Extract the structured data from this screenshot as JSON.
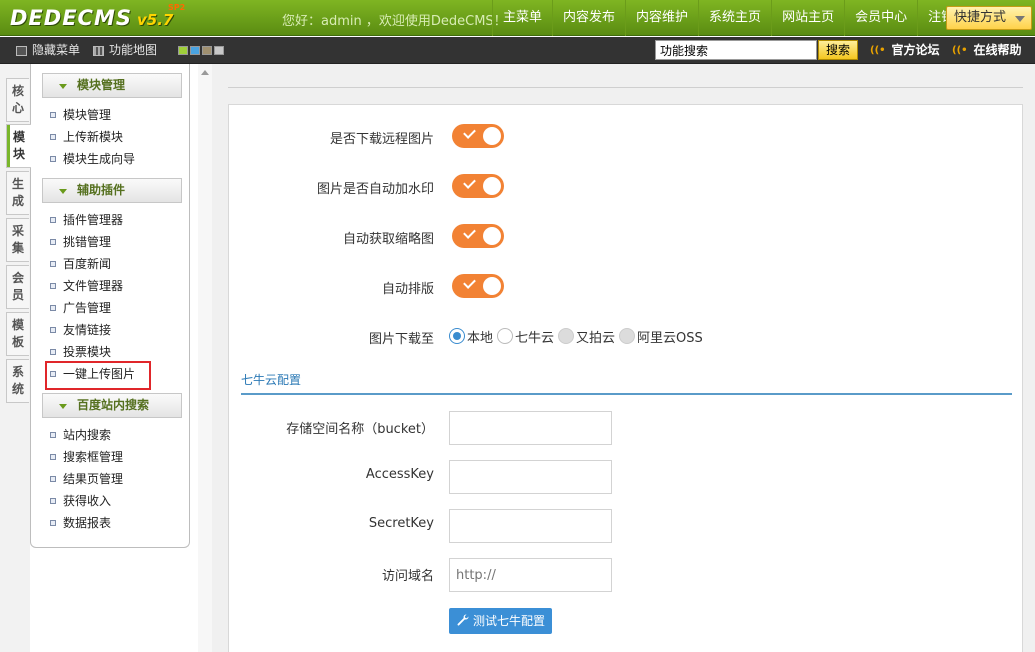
{
  "header": {
    "logo_text": "DEDECMS",
    "logo_version": "v5.7",
    "logo_edition": "SP2",
    "welcome": "您好：admin ，欢迎使用DedeCMS！",
    "nav": [
      "主菜单",
      "内容发布",
      "内容维护",
      "系统主页",
      "网站主页",
      "会员中心",
      "注销"
    ],
    "quick_label": "快捷方式"
  },
  "subbar": {
    "hide_menu": "隐藏菜单",
    "func_map": "功能地图",
    "search_value": "功能搜索",
    "search_button": "搜索",
    "forum_link": "官方论坛",
    "help_link": "在线帮助"
  },
  "vtabs": [
    "核心",
    "模块",
    "生成",
    "采集",
    "会员",
    "模板",
    "系统"
  ],
  "menu": {
    "groups": [
      {
        "title": "模块管理",
        "items": [
          "模块管理",
          "上传新模块",
          "模块生成向导"
        ]
      },
      {
        "title": "辅助插件",
        "items": [
          "插件管理器",
          "挑错管理",
          "百度新闻",
          "文件管理器",
          "广告管理",
          "友情链接",
          "投票模块",
          "一键上传图片"
        ]
      },
      {
        "title": "百度站内搜索",
        "items": [
          "站内搜索",
          "搜索框管理",
          "结果页管理",
          "获得收入",
          "数据报表"
        ]
      }
    ]
  },
  "form": {
    "toggles": [
      {
        "label": "是否下载远程图片",
        "on": true
      },
      {
        "label": "图片是否自动加水印",
        "on": true
      },
      {
        "label": "自动获取缩略图",
        "on": true
      },
      {
        "label": "自动排版",
        "on": true
      }
    ],
    "download_to_label": "图片下载至",
    "download_options": [
      "本地",
      "七牛云",
      "又拍云",
      "阿里云OSS"
    ],
    "download_selected": "本地",
    "qiniu_section_title": "七牛云配置",
    "fields": [
      {
        "label": "存储空间名称（bucket）",
        "value": "",
        "placeholder": ""
      },
      {
        "label": "AccessKey",
        "value": "",
        "placeholder": ""
      },
      {
        "label": "SecretKey",
        "value": "",
        "placeholder": ""
      },
      {
        "label": "访问域名",
        "value": "",
        "placeholder": "http://"
      }
    ],
    "test_button": "测试七牛配置"
  },
  "colors": {
    "header_green": "#6ea41b",
    "toggle_orange": "#f28234",
    "link_blue": "#2a78b5",
    "button_blue": "#3b8fd6",
    "highlight_red": "#e0262a"
  }
}
